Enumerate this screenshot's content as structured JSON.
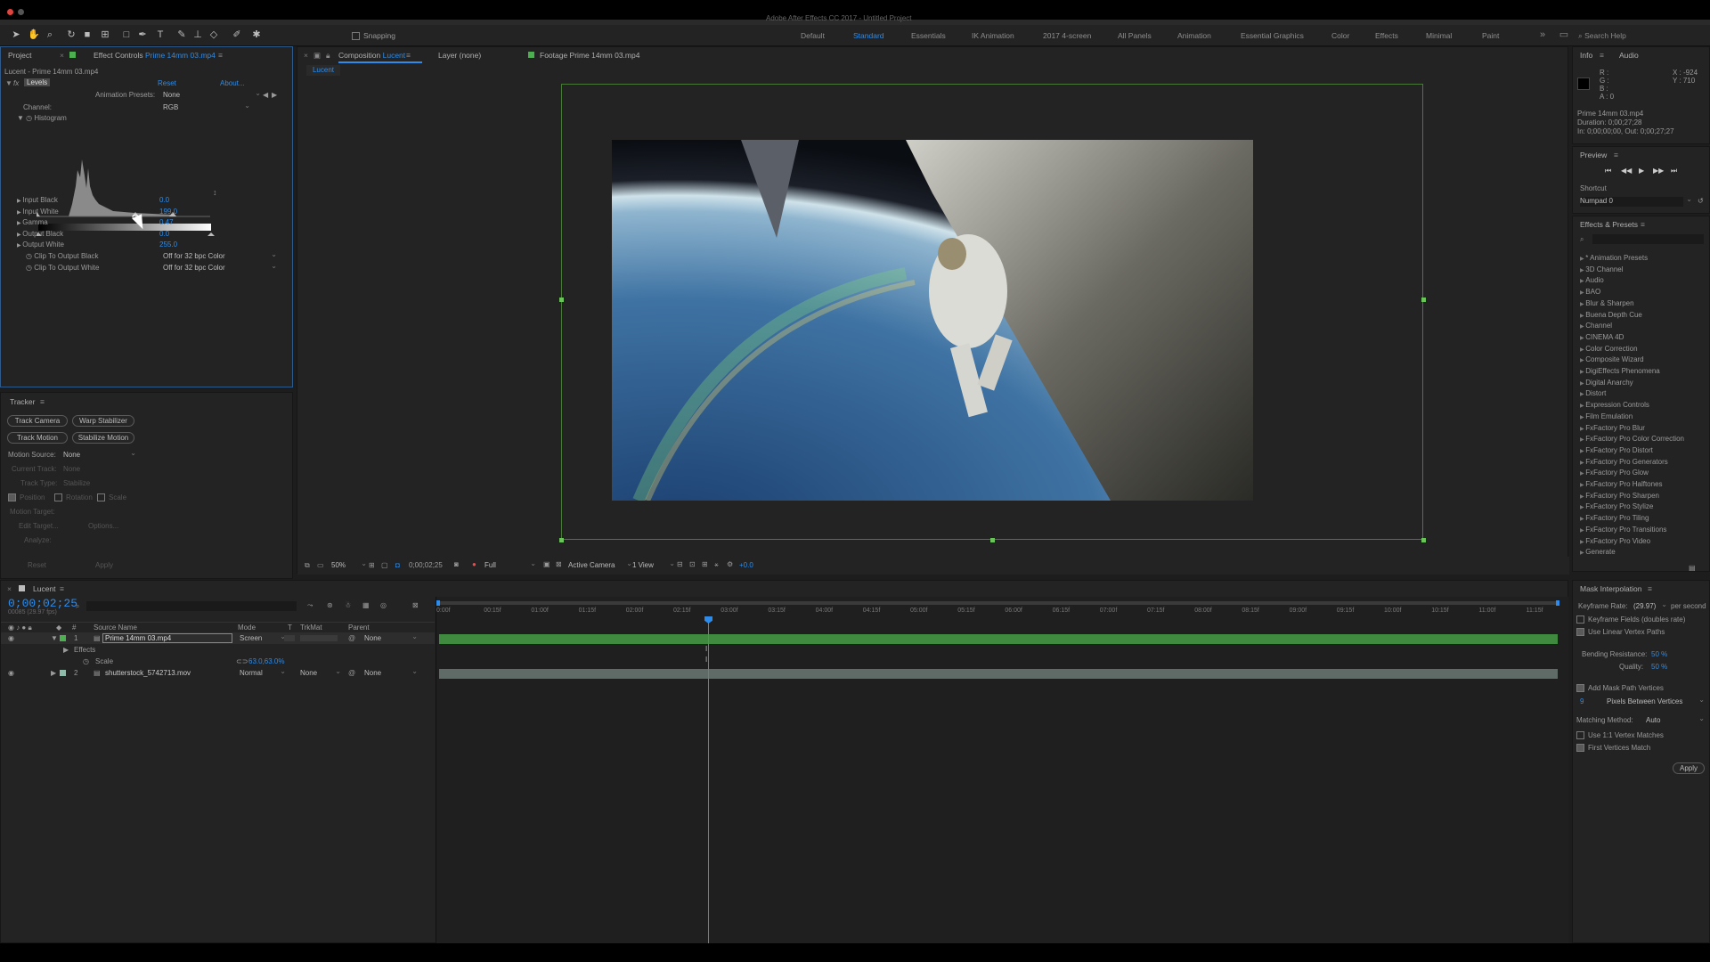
{
  "app": {
    "title": "Adobe After Effects CC 2017 - Untitled Project"
  },
  "workspaces": [
    {
      "label": "Default",
      "active": false
    },
    {
      "label": "Standard",
      "active": true
    },
    {
      "label": "Essentials",
      "active": false
    },
    {
      "label": "IK Animation",
      "active": false
    },
    {
      "label": "2017 4-screen",
      "active": false
    },
    {
      "label": "All Panels",
      "active": false
    },
    {
      "label": "Animation",
      "active": false
    },
    {
      "label": "Essential Graphics",
      "active": false
    },
    {
      "label": "Color",
      "active": false
    },
    {
      "label": "Effects",
      "active": false
    },
    {
      "label": "Minimal",
      "active": false
    },
    {
      "label": "Paint",
      "active": false
    }
  ],
  "toolbar": {
    "snapping": "Snapping",
    "search_placeholder": "Search Help"
  },
  "effect_controls": {
    "tab_project": "Project",
    "tab_label": "Effect Controls",
    "tab_file": "Prime 14mm 03.mp4",
    "layer_path": "Lucent - Prime 14mm 03.mp4",
    "effect_name": "Levels",
    "reset": "Reset",
    "about": "About...",
    "anim_presets_label": "Animation Presets:",
    "anim_presets_value": "None",
    "channel_label": "Channel:",
    "channel_value": "RGB",
    "histogram_label": "Histogram",
    "params": [
      {
        "label": "Input Black",
        "value": "0.0"
      },
      {
        "label": "Input White",
        "value": "199.0"
      },
      {
        "label": "Gamma",
        "value": "0.47"
      },
      {
        "label": "Output Black",
        "value": "0.0"
      },
      {
        "label": "Output White",
        "value": "255.0"
      }
    ],
    "clip_black_label": "Clip To Output Black",
    "clip_black_value": "Off for 32 bpc Color",
    "clip_white_label": "Clip To Output White",
    "clip_white_value": "Off for 32 bpc Color"
  },
  "tracker": {
    "title": "Tracker",
    "track_camera": "Track Camera",
    "warp_stabilizer": "Warp Stabilizer",
    "track_motion": "Track Motion",
    "stabilize_motion": "Stabilize Motion",
    "motion_source_label": "Motion Source:",
    "motion_source_value": "None",
    "current_track_label": "Current Track:",
    "current_track_value": "None",
    "track_type_label": "Track Type:",
    "track_type_value": "Stabilize",
    "position": "Position",
    "rotation": "Rotation",
    "scale": "Scale",
    "motion_target": "Motion Target:",
    "edit_target": "Edit Target...",
    "options": "Options...",
    "analyze": "Analyze:",
    "reset": "Reset",
    "apply": "Apply"
  },
  "composition": {
    "tab_label": "Composition",
    "tab_name": "Lucent",
    "layer_tab": "Layer (none)",
    "footage_tab": "Footage Prime 14mm 03.mp4",
    "sub_tab": "Lucent",
    "zoom": "50%",
    "timecode": "0;00;02;25",
    "resolution": "Full",
    "camera": "Active Camera",
    "views": "1 View",
    "exposure": "+0.0"
  },
  "info": {
    "tab_info": "Info",
    "tab_audio": "Audio",
    "r": "R :",
    "g": "G :",
    "b": "B :",
    "a": "A : 0",
    "x": "X : -924",
    "y": "Y : 710",
    "file": "Prime 14mm 03.mp4",
    "duration": "Duration: 0;00;27;28",
    "inout": "In: 0;00;00;00, Out: 0;00;27;27"
  },
  "preview": {
    "title": "Preview",
    "shortcut_label": "Shortcut",
    "shortcut_value": "Numpad 0"
  },
  "effects_presets": {
    "title": "Effects & Presets",
    "items": [
      "* Animation Presets",
      "3D Channel",
      "Audio",
      "BAO",
      "Blur & Sharpen",
      "Buena Depth Cue",
      "Channel",
      "CINEMA 4D",
      "Color Correction",
      "Composite Wizard",
      "DigiEffects Phenomena",
      "Digital Anarchy",
      "Distort",
      "Expression Controls",
      "Film Emulation",
      "FxFactory Pro Blur",
      "FxFactory Pro Color Correction",
      "FxFactory Pro Distort",
      "FxFactory Pro Generators",
      "FxFactory Pro Glow",
      "FxFactory Pro Halftones",
      "FxFactory Pro Sharpen",
      "FxFactory Pro Stylize",
      "FxFactory Pro Tiling",
      "FxFactory Pro Transitions",
      "FxFactory Pro Video",
      "Generate"
    ]
  },
  "timeline": {
    "tab": "Lucent",
    "timecode": "0;00;02;25",
    "fps": "00085 (29.97 fps)",
    "col_source": "Source Name",
    "col_mode": "Mode",
    "col_t": "T",
    "col_trkmat": "TrkMat",
    "col_parent": "Parent",
    "layers": [
      {
        "num": "1",
        "name": "Prime 14mm 03.mp4",
        "mode": "Screen",
        "trkmat": "",
        "parent": "None"
      },
      {
        "num": "2",
        "name": "shutterstock_5742713.mov",
        "mode": "Normal",
        "trkmat": "None",
        "parent": "None"
      }
    ],
    "effects_label": "Effects",
    "scale_label": "Scale",
    "scale_value": "63.0,63.0%",
    "ruler": [
      "0:00f",
      "00:15f",
      "01:00f",
      "01:15f",
      "02:00f",
      "02:15f",
      "03:00f",
      "03:15f",
      "04:00f",
      "04:15f",
      "05:00f",
      "05:15f",
      "06:00f",
      "06:15f",
      "07:00f",
      "07:15f",
      "08:00f",
      "08:15f",
      "09:00f",
      "09:15f",
      "10:00f",
      "10:15f",
      "11:00f",
      "11:15f"
    ]
  },
  "mask_interp": {
    "title": "Mask Interpolation",
    "keyframe_rate_label": "Keyframe Rate:",
    "keyframe_rate_value": "(29.97)",
    "per_second": "per second",
    "keyframe_fields": "Keyframe Fields (doubles rate)",
    "linear_vertex": "Use Linear Vertex Paths",
    "bending_label": "Bending Resistance:",
    "bending_value": "50 %",
    "quality_label": "Quality:",
    "quality_value": "50 %",
    "add_mask": "Add Mask Path Vertices",
    "pixels_value": "9",
    "pixels_between": "Pixels Between Vertices",
    "matching_label": "Matching Method:",
    "matching_value": "Auto",
    "vertex_matches": "Use 1:1 Vertex Matches",
    "first_vertices": "First Vertices Match",
    "apply": "Apply"
  },
  "colors": {
    "accent": "#2d8ceb",
    "layer_bar": "#3f8a3f",
    "label_green": "#4caf50"
  }
}
